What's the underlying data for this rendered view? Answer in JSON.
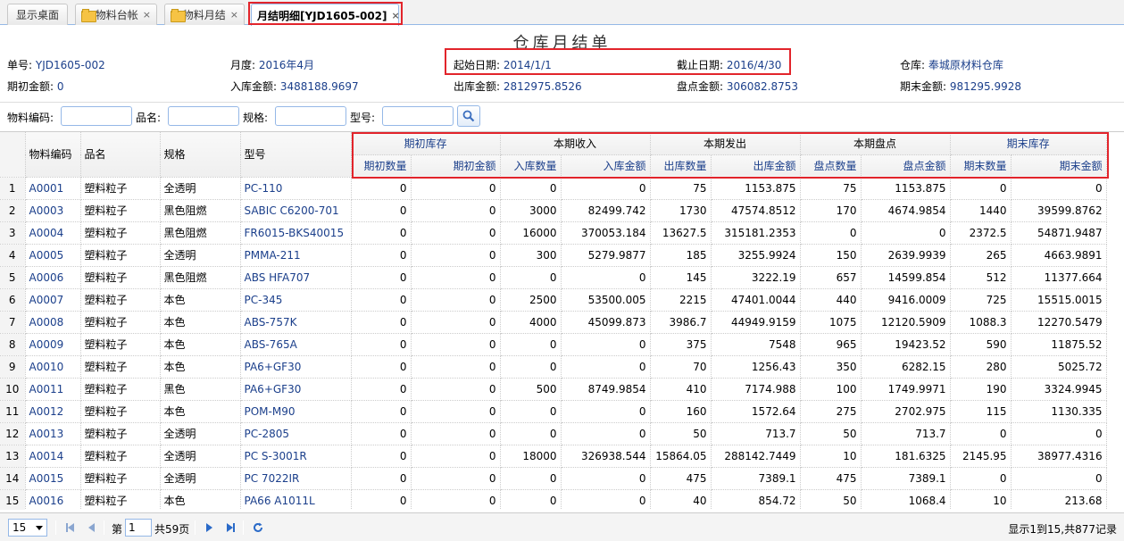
{
  "tabs": [
    {
      "label": "显示桌面",
      "icon": "",
      "closable": false
    },
    {
      "label": "物料台帐",
      "icon": "folder-icon",
      "closable": true
    },
    {
      "label": "物料月结",
      "icon": "folder-icon",
      "closable": true
    },
    {
      "label": "月结明细[YJD1605-002]",
      "icon": "",
      "closable": true,
      "active": true
    }
  ],
  "title": "仓库月结单",
  "header": {
    "doc_no_label": "单号:",
    "doc_no": "YJD1605-002",
    "month_label": "月度:",
    "month": "2016年4月",
    "start_label": "起始日期:",
    "start": "2014/1/1",
    "end_label": "截止日期:",
    "end": "2016/4/30",
    "warehouse_label": "仓库:",
    "warehouse": "奉城原材料仓库",
    "open_amt_label": "期初金额:",
    "open_amt": "0",
    "in_amt_label": "入库金额:",
    "in_amt": "3488188.9697",
    "out_amt_label": "出库金额:",
    "out_amt": "2812975.8526",
    "check_amt_label": "盘点金额:",
    "check_amt": "306082.8753",
    "end_amt_label": "期末金额:",
    "end_amt": "981295.9928"
  },
  "search": {
    "code_label": "物料编码:",
    "name_label": "品名:",
    "spec_label": "规格:",
    "model_label": "型号:",
    "code": "",
    "name": "",
    "spec": "",
    "model": ""
  },
  "columns": {
    "code": "物料编码",
    "name": "品名",
    "spec": "规格",
    "model": "型号",
    "groups": [
      "期初库存",
      "本期收入",
      "本期发出",
      "本期盘点",
      "期末库存"
    ],
    "subs": [
      "期初数量",
      "期初金额",
      "入库数量",
      "入库金额",
      "出库数量",
      "出库金额",
      "盘点数量",
      "盘点金额",
      "期末数量",
      "期末金额"
    ]
  },
  "rows": [
    [
      "1",
      "A0001",
      "塑料粒子",
      "全透明",
      "PC-110",
      "0",
      "0",
      "0",
      "0",
      "75",
      "1153.875",
      "75",
      "1153.875",
      "0",
      "0"
    ],
    [
      "2",
      "A0003",
      "塑料粒子",
      "黑色阻燃",
      "SABIC C6200-701",
      "0",
      "0",
      "3000",
      "82499.742",
      "1730",
      "47574.8512",
      "170",
      "4674.9854",
      "1440",
      "39599.8762"
    ],
    [
      "3",
      "A0004",
      "塑料粒子",
      "黑色阻燃",
      "FR6015-BKS40015",
      "0",
      "0",
      "16000",
      "370053.184",
      "13627.5",
      "315181.2353",
      "0",
      "0",
      "2372.5",
      "54871.9487"
    ],
    [
      "4",
      "A0005",
      "塑料粒子",
      "全透明",
      "PMMA-211",
      "0",
      "0",
      "300",
      "5279.9877",
      "185",
      "3255.9924",
      "150",
      "2639.9939",
      "265",
      "4663.9891"
    ],
    [
      "5",
      "A0006",
      "塑料粒子",
      "黑色阻燃",
      "ABS HFA707",
      "0",
      "0",
      "0",
      "0",
      "145",
      "3222.19",
      "657",
      "14599.854",
      "512",
      "11377.664"
    ],
    [
      "6",
      "A0007",
      "塑料粒子",
      "本色",
      "PC-345",
      "0",
      "0",
      "2500",
      "53500.005",
      "2215",
      "47401.0044",
      "440",
      "9416.0009",
      "725",
      "15515.0015"
    ],
    [
      "7",
      "A0008",
      "塑料粒子",
      "本色",
      "ABS-757K",
      "0",
      "0",
      "4000",
      "45099.873",
      "3986.7",
      "44949.9159",
      "1075",
      "12120.5909",
      "1088.3",
      "12270.5479"
    ],
    [
      "8",
      "A0009",
      "塑料粒子",
      "本色",
      "ABS-765A",
      "0",
      "0",
      "0",
      "0",
      "375",
      "7548",
      "965",
      "19423.52",
      "590",
      "11875.52"
    ],
    [
      "9",
      "A0010",
      "塑料粒子",
      "本色",
      "PA6+GF30",
      "0",
      "0",
      "0",
      "0",
      "70",
      "1256.43",
      "350",
      "6282.15",
      "280",
      "5025.72"
    ],
    [
      "10",
      "A0011",
      "塑料粒子",
      "黑色",
      "PA6+GF30",
      "0",
      "0",
      "500",
      "8749.9854",
      "410",
      "7174.988",
      "100",
      "1749.9971",
      "190",
      "3324.9945"
    ],
    [
      "11",
      "A0012",
      "塑料粒子",
      "本色",
      "POM-M90",
      "0",
      "0",
      "0",
      "0",
      "160",
      "1572.64",
      "275",
      "2702.975",
      "115",
      "1130.335"
    ],
    [
      "12",
      "A0013",
      "塑料粒子",
      "全透明",
      "PC-2805",
      "0",
      "0",
      "0",
      "0",
      "50",
      "713.7",
      "50",
      "713.7",
      "0",
      "0"
    ],
    [
      "13",
      "A0014",
      "塑料粒子",
      "全透明",
      "PC S-3001R",
      "0",
      "0",
      "18000",
      "326938.544",
      "15864.05",
      "288142.7449",
      "10",
      "181.6325",
      "2145.95",
      "38977.4316"
    ],
    [
      "14",
      "A0015",
      "塑料粒子",
      "全透明",
      "PC 7022IR",
      "0",
      "0",
      "0",
      "0",
      "475",
      "7389.1",
      "475",
      "7389.1",
      "0",
      "0"
    ],
    [
      "15",
      "A0016",
      "塑料粒子",
      "本色",
      "PA66 A1011L",
      "0",
      "0",
      "0",
      "0",
      "40",
      "854.72",
      "50",
      "1068.4",
      "10",
      "213.68"
    ]
  ],
  "pager": {
    "page_size": "15",
    "page_prefix": "第",
    "page": "1",
    "page_suffix": "共59页",
    "info": "显示1到15,共877记录"
  }
}
